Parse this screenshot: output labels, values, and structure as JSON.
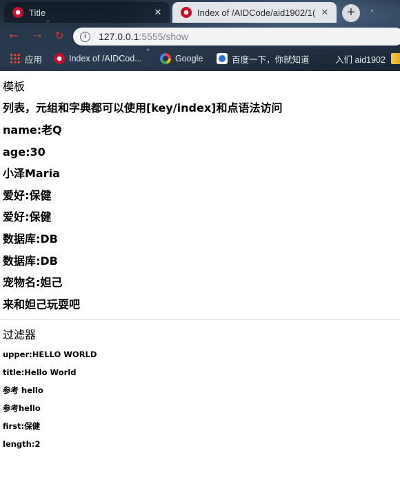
{
  "browser": {
    "tabs": [
      {
        "title": "Title",
        "active": false
      },
      {
        "title": "Index of /AIDCode/aid1902/1(",
        "active": true
      }
    ],
    "new_tab_symbol": "+",
    "close_symbol": "✕",
    "url": {
      "host": "127.0.0.1",
      "path": ":5555/show"
    },
    "bookmarks": [
      {
        "label": "应用",
        "icon": "apps-grid-icon"
      },
      {
        "label": "Index of /AIDCod...",
        "icon": "site-favicon-icon"
      },
      {
        "label": "Google",
        "icon": "google-icon"
      },
      {
        "label": "百度一下，你就知道",
        "icon": "baidu-icon"
      },
      {
        "label": "入们 aid1902",
        "icon": "folder-icon"
      }
    ]
  },
  "page": {
    "template_heading": "模板",
    "lines": [
      "列表，元组和字典都可以使用[key/index]和点语法访问",
      "name:老Q",
      "age:30",
      "小泽Maria",
      "爱好:保健",
      "爱好:保健",
      "数据库:DB",
      "数据库:DB",
      "宠物名:妲己",
      "来和妲己玩耍吧"
    ],
    "filter_heading": "过滤器",
    "filter_lines": [
      "upper:HELLO WORLD",
      "title:Hello World",
      "参考 hello",
      "参考hello",
      "first:保健",
      "length:2"
    ]
  }
}
